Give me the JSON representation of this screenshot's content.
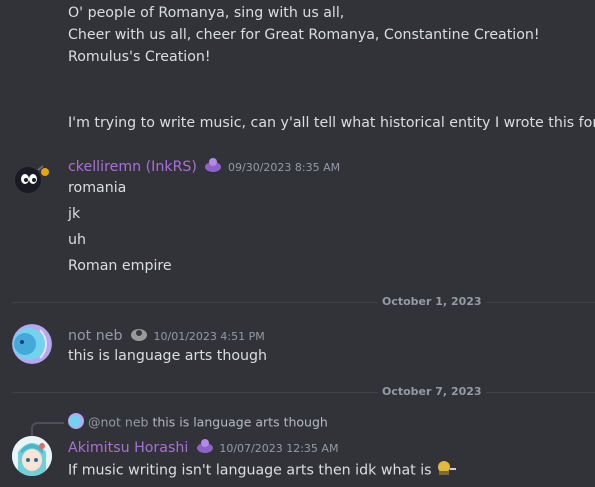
{
  "messages": [
    {
      "lines": [
        "O' people of Romanya, sing with us all,",
        "Cheer with us all, cheer for Great Romanya, Constantine Creation!",
        "Romulus's Creation!",
        "I'm trying to write music, can y'all tell what historical entity I wrote this for?"
      ]
    },
    {
      "author": "ckelliremn (InkRS)",
      "author_color": "#a970d4",
      "timestamp": "09/30/2023 8:35 AM",
      "lines": [
        "romania",
        "jk",
        "uh",
        "Roman empire"
      ]
    },
    {
      "author": "not neb",
      "author_color": "#949ba4",
      "timestamp": "10/01/2023 4:51 PM",
      "lines": [
        "this is language arts though"
      ]
    },
    {
      "author": "Akimitsu Horashi",
      "author_color": "#a970d4",
      "timestamp": "10/07/2023 12:35 AM",
      "reply": {
        "mention": "@not neb",
        "text": "this is language arts though"
      },
      "lines": [
        "If music writing isn't language arts then idk what is"
      ]
    }
  ],
  "dividers": [
    "October 1, 2023",
    "October 7, 2023"
  ],
  "colors": {
    "background": "#313338",
    "text": "#dbdee1",
    "muted": "#949ba4",
    "purple_name": "#a970d4"
  }
}
